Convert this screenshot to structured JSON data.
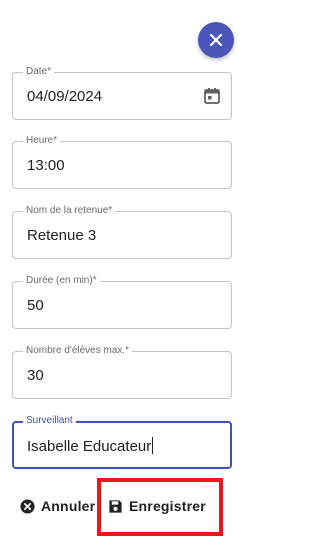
{
  "dialog": {
    "close_icon": "close-icon",
    "accent_color": "#4b57b8"
  },
  "fields": {
    "date": {
      "label": "Date*",
      "value": "04/09/2024",
      "icon": "calendar-icon"
    },
    "time": {
      "label": "Heure*",
      "value": "13:00"
    },
    "name": {
      "label": "Nom de la retenue*",
      "value": "Retenue 3"
    },
    "duration": {
      "label": "Durée (en min)*",
      "value": "50"
    },
    "max_students": {
      "label": "Nombre d'élèves max.*",
      "value": "30"
    },
    "supervisor": {
      "label": "Surveillant",
      "value": "Isabelle Educateur",
      "focused": true
    }
  },
  "actions": {
    "cancel_label": "Annuler",
    "cancel_icon": "cancel-circle-icon",
    "save_label": "Enregistrer",
    "save_icon": "floppy-disk-icon",
    "highlight_color": "#e8191e"
  }
}
